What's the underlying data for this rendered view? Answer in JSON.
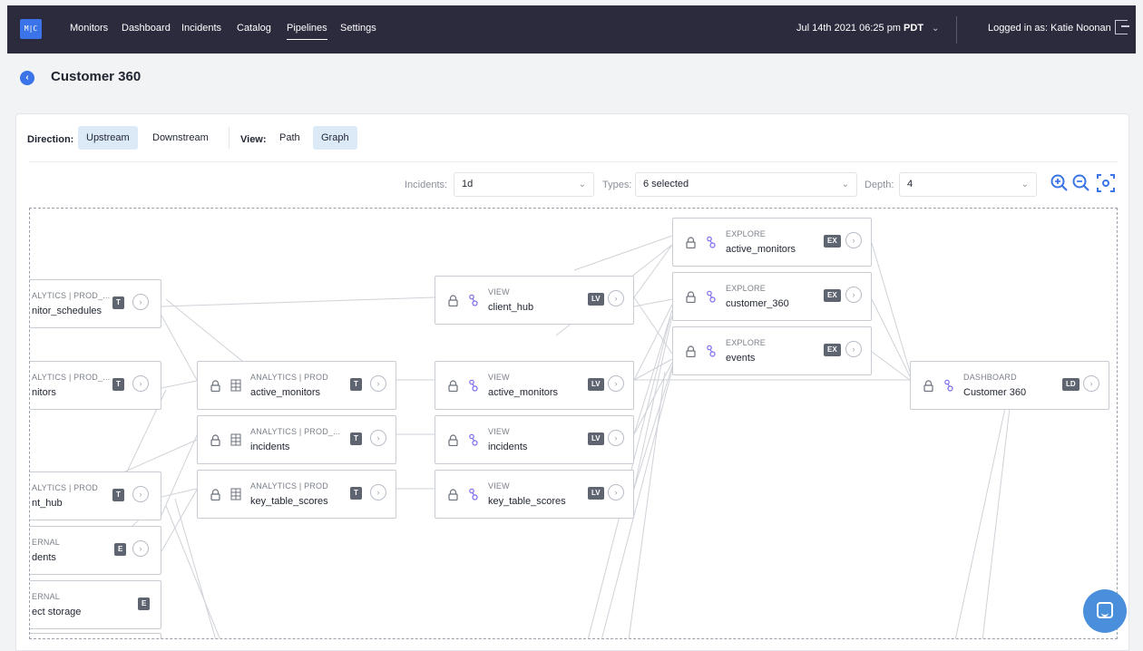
{
  "nav": {
    "logo": "M|C",
    "items": [
      "Monitors",
      "Dashboard",
      "Incidents",
      "Catalog",
      "Pipelines",
      "Settings"
    ],
    "datetime": "Jul 14th 2021 06:25 pm",
    "timezone": "PDT",
    "login": "Logged in as: Katie Noonan"
  },
  "page": {
    "title": "Customer 360"
  },
  "toolbar": {
    "direction_label": "Direction:",
    "upstream": "Upstream",
    "downstream": "Downstream",
    "view_label": "View:",
    "path": "Path",
    "graph": "Graph"
  },
  "filters": {
    "incidents_label": "Incidents:",
    "incidents_value": "1d",
    "types_label": "Types:",
    "types_value": "6 selected",
    "depth_label": "Depth:",
    "depth_value": "4"
  },
  "nodes": [
    {
      "cat": "ALYTICS | PROD_...",
      "name": "nitor_schedules",
      "badge": "T"
    },
    {
      "cat": "ALYTICS | PROD_...",
      "name": "nitors",
      "badge": "T"
    },
    {
      "cat": "ALYTICS | PROD",
      "name": "nt_hub",
      "badge": "T"
    },
    {
      "cat": "ERNAL",
      "name": "dents",
      "badge": "E"
    },
    {
      "cat": "ERNAL",
      "name": "ect storage",
      "badge": "E"
    },
    {
      "cat": "ANALYTICS | PROD",
      "name": "active_monitors",
      "badge": "T"
    },
    {
      "cat": "ANALYTICS | PROD_...",
      "name": "incidents",
      "badge": "T"
    },
    {
      "cat": "ANALYTICS | PROD",
      "name": "key_table_scores",
      "badge": "T"
    },
    {
      "cat": "VIEW",
      "name": "client_hub",
      "badge": "LV"
    },
    {
      "cat": "VIEW",
      "name": "active_monitors",
      "badge": "LV"
    },
    {
      "cat": "VIEW",
      "name": "incidents",
      "badge": "LV"
    },
    {
      "cat": "VIEW",
      "name": "key_table_scores",
      "badge": "LV"
    },
    {
      "cat": "EXPLORE",
      "name": "active_monitors",
      "badge": "EX"
    },
    {
      "cat": "EXPLORE",
      "name": "customer_360",
      "badge": "EX"
    },
    {
      "cat": "EXPLORE",
      "name": "events",
      "badge": "EX"
    },
    {
      "cat": "DASHBOARD",
      "name": "Customer 360",
      "badge": "LD"
    }
  ],
  "colors": {
    "nav_bg": "#2c2a3d",
    "accent": "#3b74e8",
    "badge": "#5e6470",
    "selected_bg": "#dceaf8"
  }
}
